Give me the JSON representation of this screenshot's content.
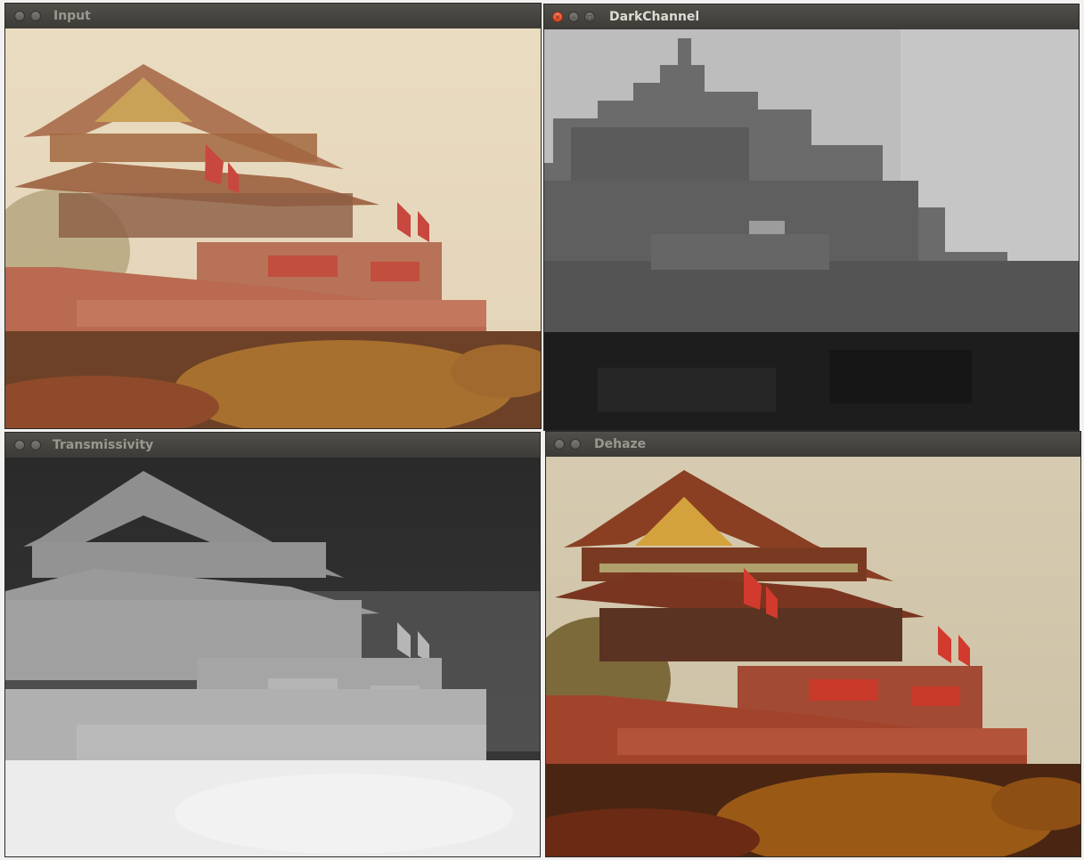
{
  "windows": {
    "input": {
      "title": "Input"
    },
    "darkchannel": {
      "title": "DarkChannel"
    },
    "transmissivity": {
      "title": "Transmissivity"
    },
    "dehaze": {
      "title": "Dehaze"
    }
  },
  "images": {
    "input": "hazy photograph of a Chinese gate tower with red flags, red walls and hedges",
    "darkchannel": "blocky grayscale dark channel map of the hazy photo",
    "transmissivity": "grayscale transmission map of the scene",
    "dehaze": "dehazed color photograph of the same gate tower"
  },
  "icons": {
    "close": "close-icon",
    "minimize": "minimize-icon",
    "maximize": "maximize-icon"
  },
  "colors": {
    "titlebar": "#3c3b37",
    "close_active": "#e8542f",
    "title_active": "#dfdbd2",
    "title_inactive": "#9a978f"
  }
}
